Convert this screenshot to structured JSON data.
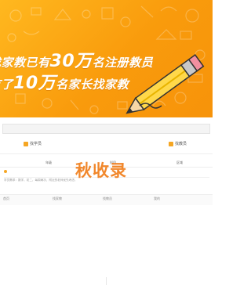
{
  "banner": {
    "line1_prefix": "找家教已有",
    "line1_big": "30万",
    "line1_suffix": "名注册教员",
    "line2_prefix": "有了",
    "line2_big": "10万",
    "line2_suffix": "名家长找家教"
  },
  "search": {
    "placeholder": ""
  },
  "tabs": [
    {
      "label": "找学员"
    },
    {
      "label": "找教员"
    }
  ],
  "filters": [
    {
      "label": "年级"
    },
    {
      "label": "科目"
    },
    {
      "label": "区域"
    }
  ],
  "list": [
    {
      "text": "学员需求：数学，初二，每周两次，附近的老师优先考虑。"
    }
  ],
  "watermark": "秋收录",
  "bottom_nav": [
    {
      "label": "首页"
    },
    {
      "label": "找家教"
    },
    {
      "label": "找教员"
    },
    {
      "label": "我的"
    }
  ],
  "colors": {
    "accent": "#f7930a",
    "watermark": "#f07d1a"
  }
}
